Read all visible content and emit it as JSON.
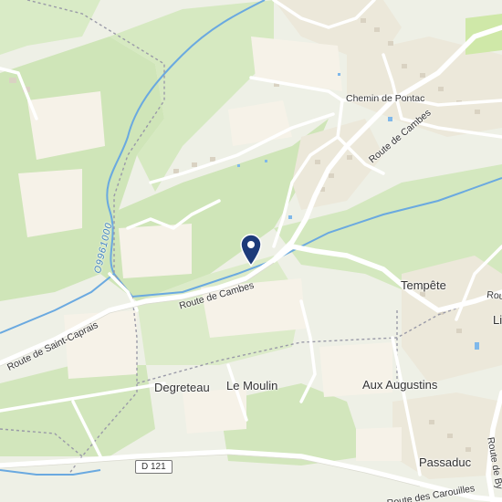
{
  "map": {
    "places": {
      "tempete": "Tempête",
      "degreteau": "Degreteau",
      "le_moulin": "Le Moulin",
      "aux_augustins": "Aux Augustins",
      "passaduc": "Passaduc",
      "li": "Li"
    },
    "roads": {
      "chemin_de_pontac": "Chemin de Pontac",
      "route_de_cambes_north": "Route de Cambes",
      "route_de_cambes": "Route de Cambes",
      "route_de_saint_caprais": "Route de Saint-Caprais",
      "route_des_carouilles": "Route des Carouilles",
      "route_east_edge": "Route",
      "route_de_by_edge": "Route de By",
      "d121_shield": "D 121"
    },
    "waterway_code": "O9961000",
    "marker": {
      "icon": "location-pin-icon",
      "color": "#1d3b7a"
    },
    "colors": {
      "water": "#6aa9e0",
      "forest": "#cfe5b8",
      "field": "#f6f2e8",
      "road": "#ffffff"
    }
  }
}
